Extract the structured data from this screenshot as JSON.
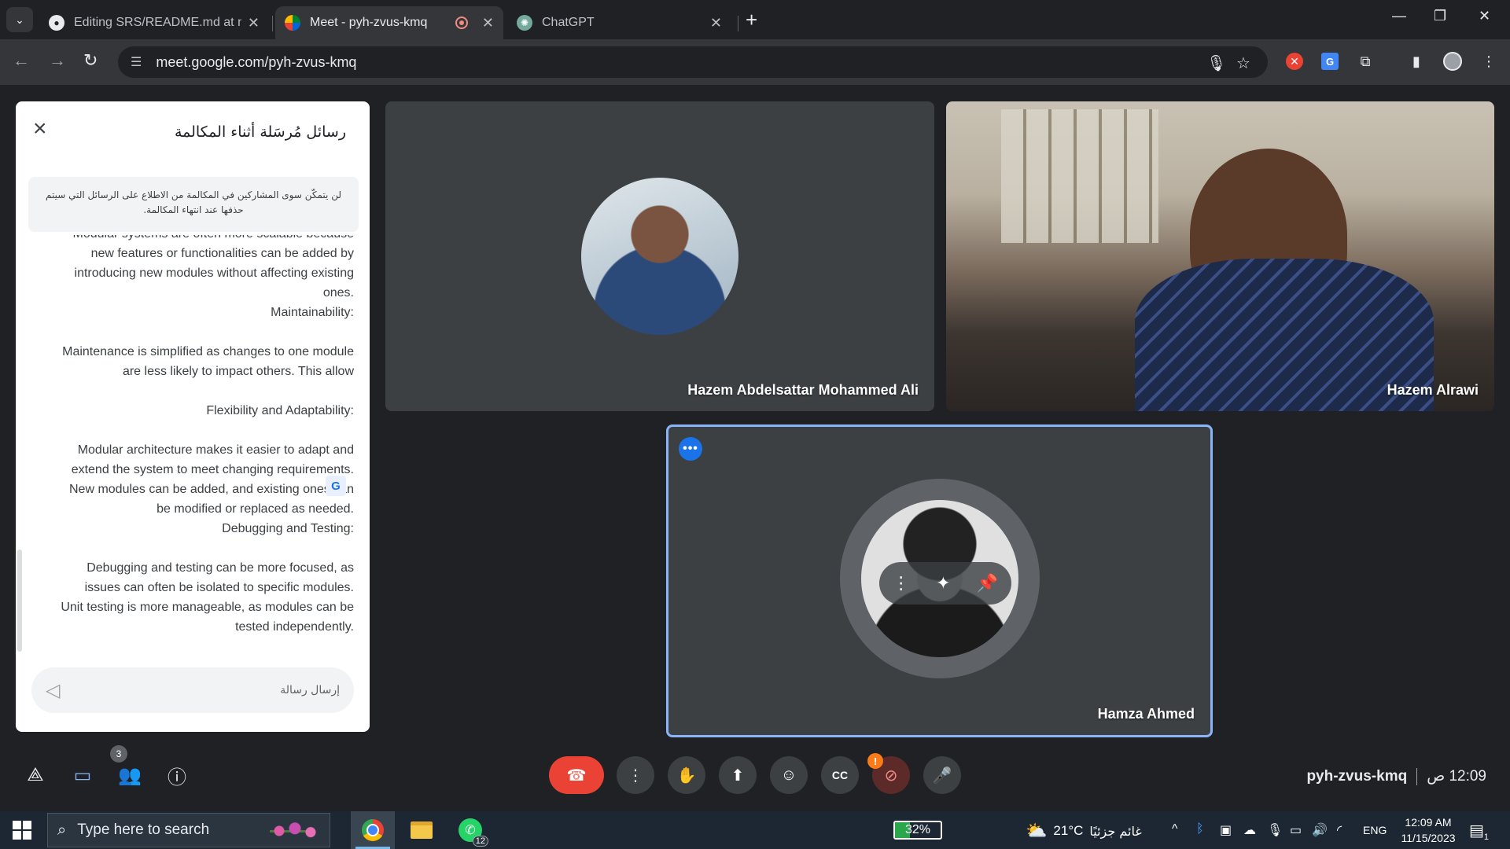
{
  "browser": {
    "tabs": [
      {
        "title": "Editing SRS/README.md at ma",
        "icon": "github-icon"
      },
      {
        "title": "Meet - pyh-zvus-kmq",
        "icon": "google-meet-icon",
        "recording": true
      },
      {
        "title": "ChatGPT",
        "icon": "chatgpt-icon"
      }
    ],
    "url": "meet.google.com/pyh-zvus-kmq"
  },
  "chat": {
    "title": "رسائل مُرسَلة أثناء المكالمة",
    "notice": "لن يتمكّن سوى المشاركين في المكالمة من الاطلاع على الرسائل التي سيتم حذفها عند انتهاء المكالمة.",
    "messages": [
      "Modular systems are often more scalable because",
      "new features or functionalities can be added by",
      "introducing new modules without affecting existing",
      "ones.",
      "Maintainability:",
      "",
      "Maintenance is simplified as changes to one module",
      "are less likely to impact others. This allow",
      "",
      "Flexibility and Adaptability:",
      "",
      "Modular architecture makes it easier to adapt and",
      "extend the system to meet changing requirements.",
      "New modules can be added, and existing ones can",
      "be modified or replaced as needed.",
      "Debugging and Testing:",
      "",
      "Debugging and testing can be more focused, as",
      "issues can often be isolated to specific modules.",
      "Unit testing is more manageable, as modules can be",
      "tested independently."
    ],
    "input_placeholder": "إرسال رسالة"
  },
  "participants": [
    {
      "name": "Hazem Abdelsattar Mohammed Ali",
      "video": false
    },
    {
      "name": "Hazem Alrawi",
      "video": true
    },
    {
      "name": "Hamza Ahmed",
      "video": false,
      "pinned_hover": true
    }
  ],
  "controls": {
    "people_count": "3",
    "meeting_code": "pyh-zvus-kmq",
    "time": "12:09 ص",
    "camera_warning": "!"
  },
  "taskbar": {
    "search_placeholder": "Type here to search",
    "whatsapp_badge": "12",
    "battery_percent": 32,
    "battery_label": "32%",
    "temperature": "21°C",
    "weather": "غائم جزئيًا",
    "language": "ENG",
    "time": "12:09 AM",
    "date": "11/15/2023",
    "notifications": "1"
  },
  "colors": {
    "meet_bg": "#202124",
    "tile_bg": "#3c4043",
    "end_call": "#ea4335",
    "active_speaker_border": "#8ab4f8",
    "accent": "#1a73e8"
  }
}
